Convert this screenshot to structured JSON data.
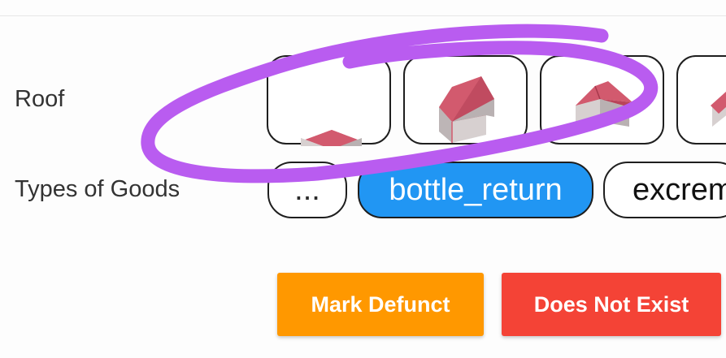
{
  "form": {
    "roof_label": "Roof",
    "goods_label": "Types of Goods"
  },
  "roof_options": {
    "roof_colors": {
      "roof_top": "#d25a6e",
      "roof_side": "#b94459",
      "wall_light": "#d7d0d0",
      "wall_dark": "#b9b1b2"
    }
  },
  "goods_chips": {
    "more_label": "...",
    "selected_label": "bottle_return",
    "next_label": "excrem",
    "selected_color": "#2196f3"
  },
  "actions": {
    "mark_defunct_label": "Mark Defunct",
    "does_not_exist_label": "Does Not Exist",
    "mark_defunct_color": "#ff9800",
    "does_not_exist_color": "#f44336"
  },
  "annotation": {
    "stroke_color": "#b95cf0"
  }
}
